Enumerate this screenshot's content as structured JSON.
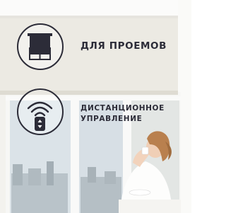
{
  "features": [
    {
      "icon": "roller-blind-icon",
      "label": "ДЛЯ ПРОЕМОВ"
    },
    {
      "icon": "remote-control-icon",
      "label_line1": "ДИСТАНЦИОННОЕ",
      "label_line2": "УПРАВЛЕНИЕ"
    }
  ],
  "colors": {
    "accent": "#2c2c38",
    "blind": "#ebe9e2",
    "wall": "#f4f3ef"
  }
}
